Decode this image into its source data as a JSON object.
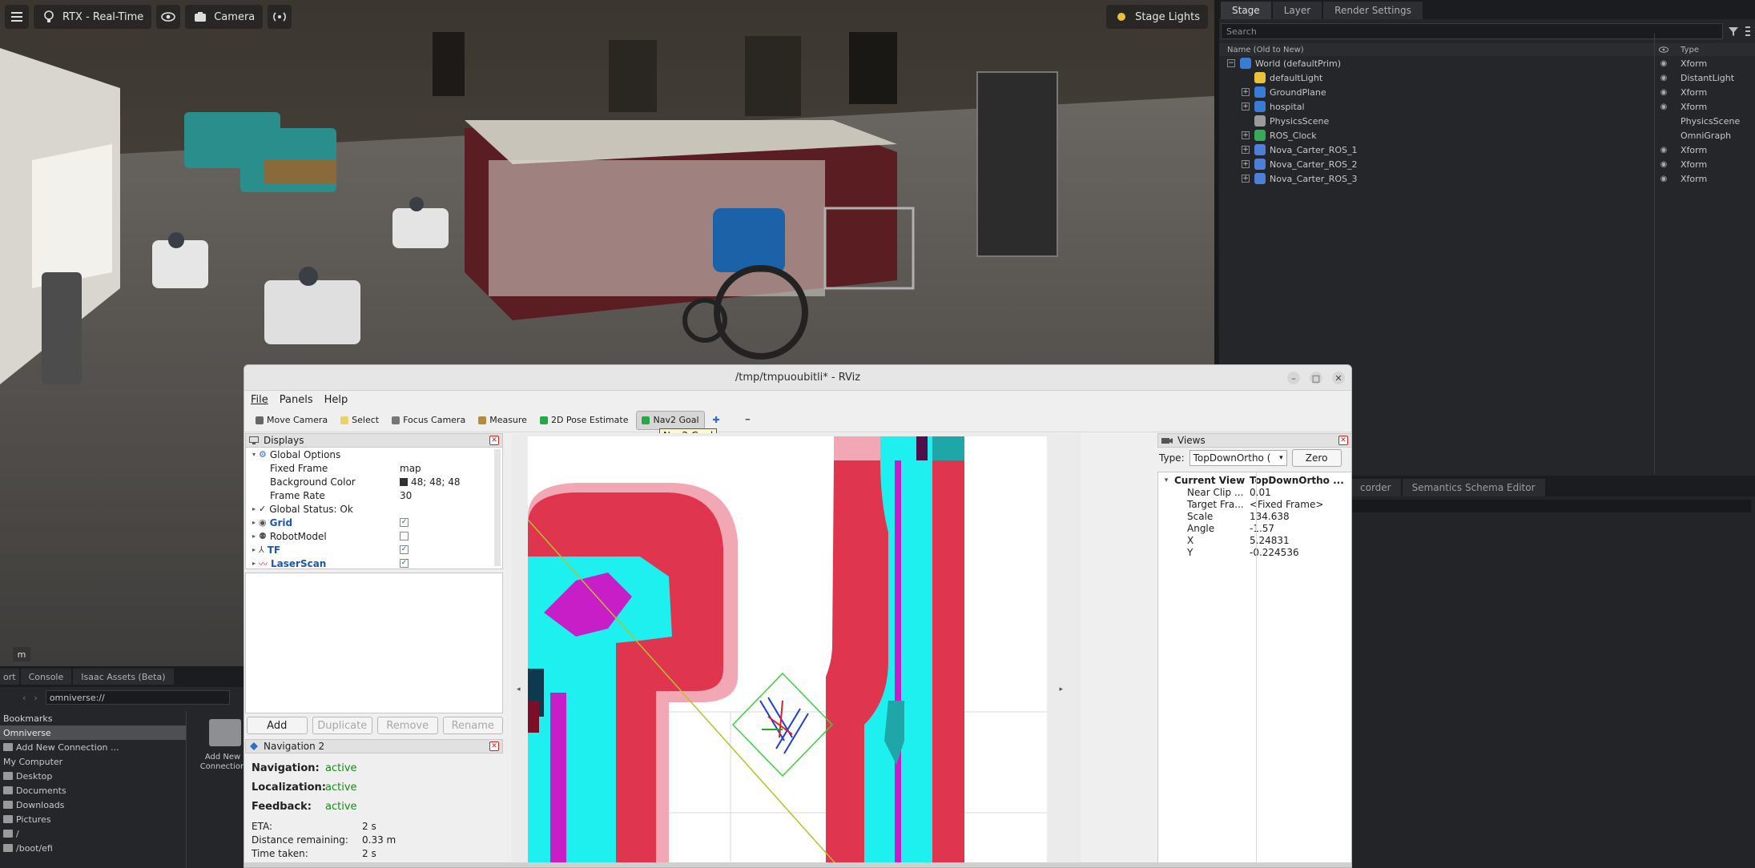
{
  "viewport": {
    "toolbar": {
      "renderer_label": "RTX - Real-Time",
      "camera_label": "Camera",
      "stage_lights_label": "Stage Lights"
    },
    "corner_label": "m"
  },
  "stage": {
    "tabs": [
      "Stage",
      "Layer",
      "Render Settings"
    ],
    "search_placeholder": "Search",
    "columns": {
      "name": "Name (Old to New)",
      "type": "Type"
    },
    "rows": [
      {
        "name": "World (defaultPrim)",
        "type": "Xform",
        "level": 0,
        "expander": "−",
        "icon": "xform-icon",
        "visible": true
      },
      {
        "name": "defaultLight",
        "type": "DistantLight",
        "level": 1,
        "expander": "",
        "icon": "light-icon",
        "visible": true
      },
      {
        "name": "GroundPlane",
        "type": "Xform",
        "level": 1,
        "expander": "+",
        "icon": "xform-icon",
        "visible": true
      },
      {
        "name": "hospital",
        "type": "Xform",
        "level": 1,
        "expander": "+",
        "icon": "xform-icon",
        "visible": true
      },
      {
        "name": "PhysicsScene",
        "type": "PhysicsScene",
        "level": 1,
        "expander": "",
        "icon": "physics-icon",
        "visible": false
      },
      {
        "name": "ROS_Clock",
        "type": "OmniGraph",
        "level": 1,
        "expander": "+",
        "icon": "graph-icon",
        "visible": false
      },
      {
        "name": "Nova_Carter_ROS_1",
        "type": "Xform",
        "level": 1,
        "expander": "+",
        "icon": "robot-icon",
        "visible": true
      },
      {
        "name": "Nova_Carter_ROS_2",
        "type": "Xform",
        "level": 1,
        "expander": "+",
        "icon": "robot-icon",
        "visible": true
      },
      {
        "name": "Nova_Carter_ROS_3",
        "type": "Xform",
        "level": 1,
        "expander": "+",
        "icon": "robot-icon",
        "visible": true
      }
    ]
  },
  "bottom_right": {
    "tabs": [
      "corder",
      "Semantics Schema Editor"
    ]
  },
  "content_browser": {
    "tabs": [
      "ort",
      "Console",
      "Isaac Assets (Beta)"
    ],
    "address": "omniverse://",
    "tree": [
      {
        "label": "Bookmarks",
        "kind": "header"
      },
      {
        "label": "Omniverse",
        "kind": "selected"
      },
      {
        "label": "Add New Connection ...",
        "kind": "item"
      },
      {
        "label": "My Computer",
        "kind": "item"
      },
      {
        "label": "Desktop",
        "kind": "folder"
      },
      {
        "label": "Documents",
        "kind": "folder"
      },
      {
        "label": "Downloads",
        "kind": "folder"
      },
      {
        "label": "Pictures",
        "kind": "folder"
      },
      {
        "label": "/",
        "kind": "folder"
      },
      {
        "label": "/boot/efi",
        "kind": "folder"
      }
    ],
    "add_new_label": "Add New Connection"
  },
  "rviz": {
    "title": "/tmp/tmpuoubitli* - RViz",
    "menu": [
      "File",
      "Panels",
      "Help"
    ],
    "tools": [
      {
        "label": "Move Camera",
        "icon": "move-camera-icon"
      },
      {
        "label": "Select",
        "icon": "select-icon"
      },
      {
        "label": "Focus Camera",
        "icon": "focus-camera-icon"
      },
      {
        "label": "Measure",
        "icon": "measure-icon"
      },
      {
        "label": "2D Pose Estimate",
        "icon": "pose-estimate-icon"
      },
      {
        "label": "Nav2 Goal",
        "icon": "nav-goal-icon",
        "active": true
      }
    ],
    "tooltip": "Nav2 Goal",
    "displays": {
      "title": "Displays",
      "rows": [
        {
          "name": "Global Options",
          "value": "",
          "arrow": "▾",
          "icon": "gear-icon",
          "indent": 0
        },
        {
          "name": "Fixed Frame",
          "value": "map",
          "arrow": "",
          "icon": "",
          "indent": 1
        },
        {
          "name": "Background Color",
          "value": "48; 48; 48",
          "arrow": "",
          "icon": "",
          "indent": 1,
          "swatch": "#303030"
        },
        {
          "name": "Frame Rate",
          "value": "30",
          "arrow": "",
          "icon": "",
          "indent": 1
        },
        {
          "name": "Global Status: Ok",
          "value": "",
          "arrow": "▸",
          "icon": "check-icon",
          "indent": 0
        },
        {
          "name": "Grid",
          "value": "",
          "arrow": "▸",
          "icon": "grid-icon",
          "indent": 0,
          "blue": true,
          "check": "✓"
        },
        {
          "name": "RobotModel",
          "value": "",
          "arrow": "▸",
          "icon": "robot-model-icon",
          "indent": 0,
          "check": ""
        },
        {
          "name": "TF",
          "value": "",
          "arrow": "▸",
          "icon": "tf-icon",
          "indent": 0,
          "blue": true,
          "check": "✓"
        },
        {
          "name": "LaserScan",
          "value": "",
          "arrow": "▸",
          "icon": "laserscan-icon",
          "indent": 0,
          "blue": true,
          "check": "✓"
        }
      ],
      "buttons": [
        "Add",
        "Duplicate",
        "Remove",
        "Rename"
      ]
    },
    "navigation": {
      "title": "Navigation 2",
      "status": [
        {
          "label": "Navigation:",
          "value": "active"
        },
        {
          "label": "Localization:",
          "value": "active"
        },
        {
          "label": "Feedback:",
          "value": "active"
        }
      ],
      "metrics": [
        {
          "label": "ETA:",
          "value": "2 s"
        },
        {
          "label": "Distance remaining:",
          "value": "0.33 m"
        },
        {
          "label": "Time taken:",
          "value": "2 s"
        }
      ]
    },
    "views": {
      "title": "Views",
      "type_label": "Type:",
      "type_value": "TopDownOrtho (",
      "zero_label": "Zero",
      "current_view": {
        "label": "Current View",
        "value": "TopDownOrtho ..."
      },
      "props": [
        {
          "name": "Near Clip ...",
          "value": "0.01"
        },
        {
          "name": "Target Fra...",
          "value": "<Fixed Frame>"
        },
        {
          "name": "Scale",
          "value": "134.638"
        },
        {
          "name": "Angle",
          "value": "-1.57"
        },
        {
          "name": "X",
          "value": "5.24831"
        },
        {
          "name": "Y",
          "value": "-0.224536"
        }
      ]
    }
  },
  "colors": {
    "costmap_red": "#e0354f",
    "costmap_pink": "#f2a8b4",
    "costmap_cyan": "#1ef0f0",
    "costmap_magenta": "#c81ec8",
    "path_yellow": "#b8c02a"
  }
}
